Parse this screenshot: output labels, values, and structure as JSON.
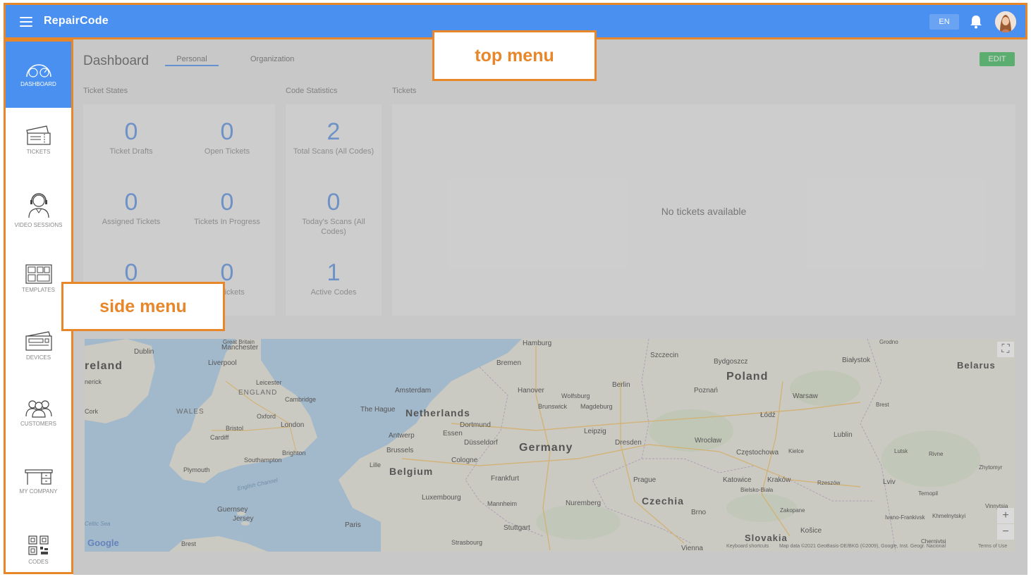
{
  "app": {
    "brand": "RepairCode"
  },
  "topbar": {
    "lang": "EN",
    "icons": [
      "menu-icon",
      "bell-icon",
      "avatar"
    ]
  },
  "sidebar": {
    "items": [
      {
        "label": "DASHBOARD",
        "icon": "speedometer-icon",
        "active": true
      },
      {
        "label": "TICKETS",
        "icon": "tickets-icon"
      },
      {
        "label": "VIDEO SESSIONS",
        "icon": "headset-agent-icon"
      },
      {
        "label": "TEMPLATES",
        "icon": "templates-grid-icon"
      },
      {
        "label": "DEVICES",
        "icon": "printer-device-icon"
      },
      {
        "label": "CUSTOMERS",
        "icon": "people-group-icon"
      },
      {
        "label": "MY COMPANY",
        "icon": "desk-icon"
      },
      {
        "label": "CODES",
        "icon": "qr-code-icon"
      }
    ]
  },
  "dashboard": {
    "title": "Dashboard",
    "tabs": [
      {
        "label": "Personal",
        "active": true
      },
      {
        "label": "Organization"
      }
    ],
    "edit_label": "EDIT",
    "sections": {
      "ticket_states": "Ticket States",
      "code_statistics": "Code Statistics",
      "tickets": "Tickets"
    },
    "ticket_states": [
      {
        "value": "0",
        "label": "Ticket Drafts"
      },
      {
        "value": "0",
        "label": "Open Tickets"
      },
      {
        "value": "0",
        "label": "Assigned Tickets"
      },
      {
        "value": "0",
        "label": "Tickets In Progress"
      },
      {
        "value": "0",
        "label": ""
      },
      {
        "value": "0",
        "label": "ed Tickets"
      }
    ],
    "code_statistics": [
      {
        "value": "2",
        "label": "Total Scans (All Codes)"
      },
      {
        "value": "0",
        "label": "Today's Scans (All Codes)"
      },
      {
        "value": "1",
        "label": "Active Codes"
      }
    ],
    "tickets_empty": "No tickets available"
  },
  "map": {
    "countries": [
      "reland",
      "Netherlands",
      "Belgium",
      "Germany",
      "Poland",
      "Czechia",
      "Slovakia",
      "Belarus"
    ],
    "regions": [
      "ENGLAND",
      "WALES"
    ],
    "cities": [
      "Dublin",
      "Manchester",
      "Liverpool",
      "Leicester",
      "Cambridge",
      "Oxford",
      "London",
      "Bristol",
      "Cardiff",
      "Brighton",
      "Southampton",
      "Plymouth",
      "Cork",
      "nerick",
      "Guernsey",
      "Jersey",
      "Brest",
      "Paris",
      "Lille",
      "Brussels",
      "Antwerp",
      "Essen",
      "Düsseldorf",
      "Dortmund",
      "Cologne",
      "Luxembourg",
      "Frankfurt",
      "Mannheim",
      "Strasbourg",
      "Stuttgart",
      "Nuremberg",
      "Hamburg",
      "Bremen",
      "Hanover",
      "Wolfsburg",
      "Brunswick",
      "Magdeburg",
      "Berlin",
      "Leipzig",
      "Dresden",
      "Prague",
      "Brno",
      "Vienna",
      "Amsterdam",
      "The Hague",
      "Szczecin",
      "Bydgoszcz",
      "Poznań",
      "Łódź",
      "Warsaw",
      "Wrocław",
      "Częstochowa",
      "Kielce",
      "Katowice",
      "Kraków",
      "Bielsko-Biała",
      "Rzeszów",
      "Lublin",
      "Białystok",
      "Grodno",
      "Brest",
      "Lutsk",
      "Rivne",
      "Lviv",
      "Ternopil",
      "Zhytomyr",
      "Vinnytsia",
      "Ivano-Frankivsk",
      "Khmelnytskyi",
      "Chernivtsi",
      "Zakopane",
      "Košice",
      "Great Britain"
    ],
    "seas": [
      "English Channel",
      "Celtic Sea"
    ],
    "google": "Google",
    "attribution": [
      "Keyboard shortcuts",
      "Map data ©2021 GeoBasis-DE/BKG (©2009), Google, Inst. Geogr. Nacional",
      "Terms of Use"
    ],
    "controls": [
      "fullscreen-icon",
      "zoom-in-icon",
      "zoom-out-icon"
    ]
  },
  "callouts": {
    "top": "top menu",
    "side": "side menu"
  }
}
